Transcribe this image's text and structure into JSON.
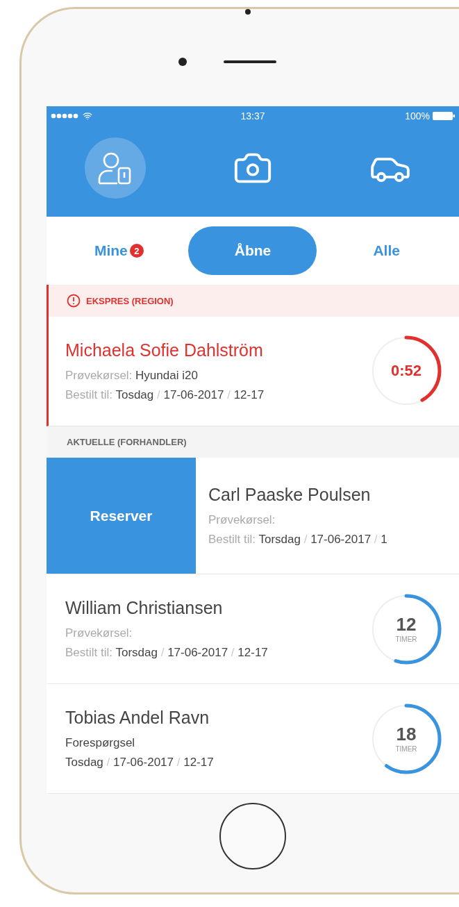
{
  "status_bar": {
    "time": "13:37",
    "battery": "100%"
  },
  "nav": [
    {
      "kind": "profile",
      "selected": true
    },
    {
      "kind": "camera",
      "selected": false
    },
    {
      "kind": "car",
      "selected": false
    }
  ],
  "tabs": [
    {
      "label": "Mine",
      "badge": "2",
      "selected": false
    },
    {
      "label": "Åbne",
      "selected": true
    },
    {
      "label": "Alle",
      "selected": false
    }
  ],
  "sections": [
    {
      "kind": "alert",
      "title": "EKSPRES (REGION)",
      "items": [
        {
          "kind": "urgent",
          "name": "Michaela Sofie Dahlström",
          "lines": [
            [
              {
                "text": "Prøvekørsel:",
                "kind": "label"
              },
              {
                "text": "Hyundai i20",
                "kind": "value"
              }
            ],
            [
              {
                "text": "Bestilt til:",
                "kind": "label"
              },
              {
                "text": "Tosdag",
                "kind": "value"
              },
              {
                "text": "/",
                "kind": "separator"
              },
              {
                "text": "17-06-2017",
                "kind": "value"
              },
              {
                "text": "/",
                "kind": "separator"
              },
              {
                "text": "12-17",
                "kind": "value"
              }
            ]
          ],
          "timer": {
            "value": "0:52",
            "level": 0.42
          }
        }
      ]
    },
    {
      "kind": "plain",
      "title": "AKTUELLE (FORHANDLER)",
      "items": [
        {
          "kind": "swiped",
          "action": "Reserver",
          "name": "Carl Paaske Poulsen",
          "lines": [
            [
              {
                "text": "Prøvekørsel:",
                "kind": "label"
              }
            ],
            [
              {
                "text": "Bestilt til:",
                "kind": "label"
              },
              {
                "text": "Torsdag",
                "kind": "value"
              },
              {
                "text": "/",
                "kind": "separator"
              },
              {
                "text": "17-06-2017",
                "kind": "value"
              },
              {
                "text": "/",
                "kind": "separator"
              },
              {
                "text": "1",
                "kind": "value"
              }
            ]
          ]
        },
        {
          "kind": "normal",
          "name": "William Christiansen",
          "lines": [
            [
              {
                "text": "Prøvekørsel:",
                "kind": "label"
              }
            ],
            [
              {
                "text": "Bestilt til:",
                "kind": "label"
              },
              {
                "text": "Torsdag",
                "kind": "value"
              },
              {
                "text": "/",
                "kind": "separator"
              },
              {
                "text": "17-06-2017",
                "kind": "value"
              },
              {
                "text": "/",
                "kind": "separator"
              },
              {
                "text": "12-17",
                "kind": "value"
              }
            ]
          ],
          "timer": {
            "value": "12",
            "unit": "TIMER",
            "level": 0.55
          }
        },
        {
          "kind": "normal",
          "name": "Tobias Andel Ravn",
          "lines": [
            [
              {
                "text": "Forespørgsel",
                "kind": "value"
              }
            ],
            [
              {
                "text": "Tosdag",
                "kind": "value"
              },
              {
                "text": "/",
                "kind": "separator"
              },
              {
                "text": "17-06-2017",
                "kind": "value"
              },
              {
                "text": "/",
                "kind": "separator"
              },
              {
                "text": "12-17",
                "kind": "value"
              }
            ]
          ],
          "timer": {
            "value": "18",
            "unit": "TIMER",
            "level": 0.6
          }
        }
      ]
    }
  ]
}
